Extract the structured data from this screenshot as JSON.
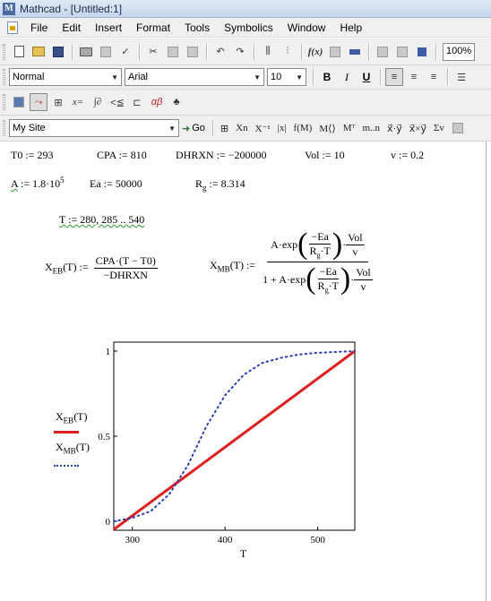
{
  "window": {
    "title": "Mathcad - [Untitled:1]",
    "app_icon": "M"
  },
  "menu": {
    "items": [
      "File",
      "Edit",
      "Insert",
      "Format",
      "Tools",
      "Symbolics",
      "Window",
      "Help"
    ]
  },
  "toolbar_standard": {
    "icons": [
      "new-icon",
      "open-icon",
      "save-icon",
      "print-icon",
      "print-preview-icon",
      "spellcheck-icon",
      "cut-icon",
      "copy-icon",
      "paste-icon",
      "undo-icon",
      "redo-icon",
      "align-horizontal-icon",
      "align-vertical-icon",
      "insert-function-icon",
      "insert-unit-icon",
      "calculate-icon",
      "insert-component-icon",
      "resource-center-icon",
      "help-icon"
    ],
    "function_label": "f(x)",
    "zoom": "100%"
  },
  "toolbar_formatting": {
    "style": "Normal",
    "font": "Arial",
    "size": "10",
    "bold": "B",
    "italic": "I",
    "underline": "U"
  },
  "toolbar_math": {
    "symbols": [
      "⊞",
      "x=",
      "∫∂",
      "<≦",
      "αβ"
    ]
  },
  "toolbar_resources": {
    "site": "My Site",
    "go": "Go",
    "matrix_symbols": [
      "⊞",
      "Xn",
      "X⁻¹",
      "|x|",
      "f(M)",
      "M⟨⟩",
      "Mᵀ",
      "m..n",
      "x⃗·y⃗",
      "x⃗×y⃗",
      "Σv"
    ]
  },
  "worksheet": {
    "defs_row1": [
      {
        "name": "T0",
        "value": "293"
      },
      {
        "name": "CPA",
        "value": "810"
      },
      {
        "name": "DHRXN",
        "value": "−200000"
      },
      {
        "name": "Vol",
        "value": "10"
      },
      {
        "name": "v",
        "value": "0.2"
      }
    ],
    "A_name": "A",
    "A_mantissa": "1.8·10",
    "A_exp": "5",
    "Ea_name": "Ea",
    "Ea_value": "50000",
    "Rg_name": "R",
    "Rg_sub": "g",
    "Rg_value": "8.314",
    "range_def": "T := 280, 285 .. 540",
    "xeb": {
      "lhs_X": "X",
      "lhs_sub": "EB",
      "lhs_arg": "(T) :=",
      "num": "CPA·(T − T0)",
      "den": "−DHRXN"
    },
    "xmb": {
      "lhs_X": "X",
      "lhs_sub": "MB",
      "lhs_arg": "(T) :=",
      "coef": "A·exp",
      "one_plus": "1 + A·exp",
      "neg_ea": "−Ea",
      "rgt": "R",
      "rgt_sub": "g",
      "rgt_rest": "·T",
      "vol": "Vol",
      "v": "v",
      "dot": "·"
    }
  },
  "chart_data": {
    "type": "line",
    "xlabel": "T",
    "xlim": [
      280,
      540
    ],
    "ylim": [
      0,
      1
    ],
    "x_ticks": [
      "300",
      "400",
      "500"
    ],
    "y_ticks": [
      "0",
      "0.5",
      "1"
    ],
    "legend_position": "left",
    "series": [
      {
        "name": "XEB(T)",
        "name_main": "X",
        "name_sub": "EB",
        "name_arg": "(T)",
        "style": "solid",
        "color": "#e02020",
        "x": [
          280,
          540
        ],
        "y": [
          -0.048,
          1.0
        ]
      },
      {
        "name": "XMB(T)",
        "name_main": "X",
        "name_sub": "MB",
        "name_arg": "(T)",
        "style": "dotted",
        "color": "#2a3fb0",
        "x": [
          280,
          300,
          320,
          340,
          360,
          380,
          400,
          420,
          440,
          460,
          480,
          500,
          520,
          540
        ],
        "y": [
          0.0,
          0.02,
          0.06,
          0.16,
          0.33,
          0.56,
          0.74,
          0.86,
          0.93,
          0.96,
          0.98,
          0.99,
          0.995,
          1.0
        ]
      }
    ]
  }
}
